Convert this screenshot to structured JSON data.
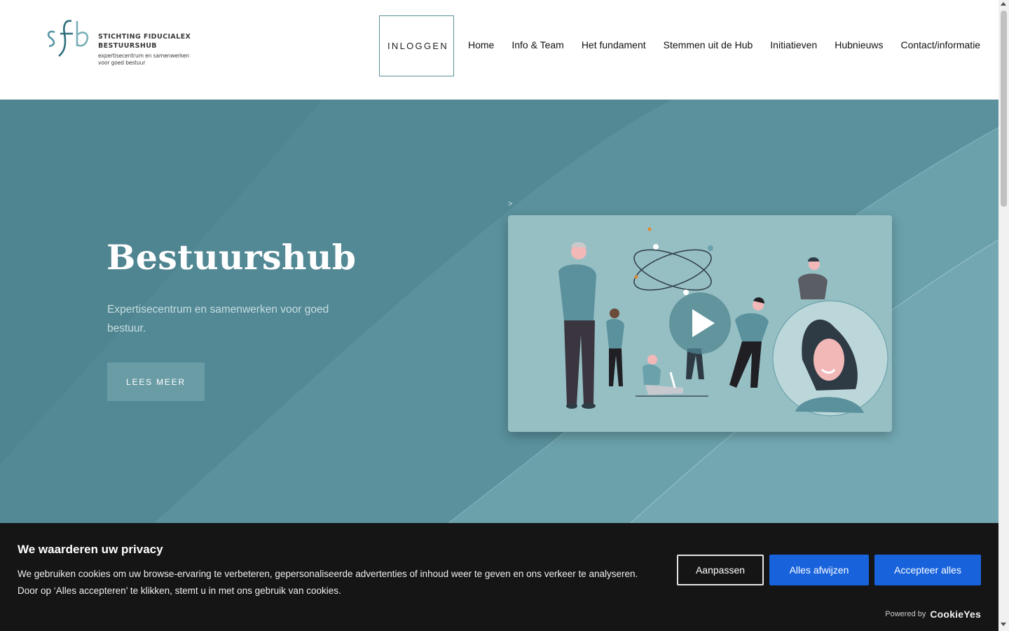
{
  "header": {
    "logo_name_line1": "STICHTING FIDUCIALEX",
    "logo_name_line2": "BESTUURSHUB",
    "logo_tag_line1": "expertisecentrum en samenwerken",
    "logo_tag_line2": "voor goed bestuur",
    "login_label": "INLOGGEN",
    "nav": [
      "Home",
      "Info & Team",
      "Het fundament",
      "Stemmen uit de Hub",
      "Initiatieven",
      "Hubnieuws",
      "Contact/informatie"
    ]
  },
  "hero": {
    "title": "Bestuurshub",
    "subtitle": "Expertisecentrum en samenwerken voor goed bestuur.",
    "button_label": "LEES MEER",
    "stray_text": ">"
  },
  "cookie_banner": {
    "title": "We waarderen uw privacy",
    "text_line1": "We gebruiken cookies om uw browse-ervaring te verbeteren, gepersonaliseerde advertenties of inhoud weer te geven en ons verkeer te analyseren.",
    "text_line2": "Door op ‘Alles accepteren’ te klikken, stemt u in met ons gebruik van cookies.",
    "customize_label": "Aanpassen",
    "reject_label": "Alles afwijzen",
    "accept_label": "Accepteer alles",
    "powered_label": "Powered by",
    "brand": "CookieYes"
  },
  "colors": {
    "hero_bg": "#4f8590",
    "accent_blue": "#1863dc",
    "banner_bg": "#151516",
    "video_bg": "#96bfc4"
  },
  "icons": {
    "play": "play-icon",
    "scroll_up": "chevron-up-icon",
    "scroll_down": "chevron-down-icon"
  }
}
